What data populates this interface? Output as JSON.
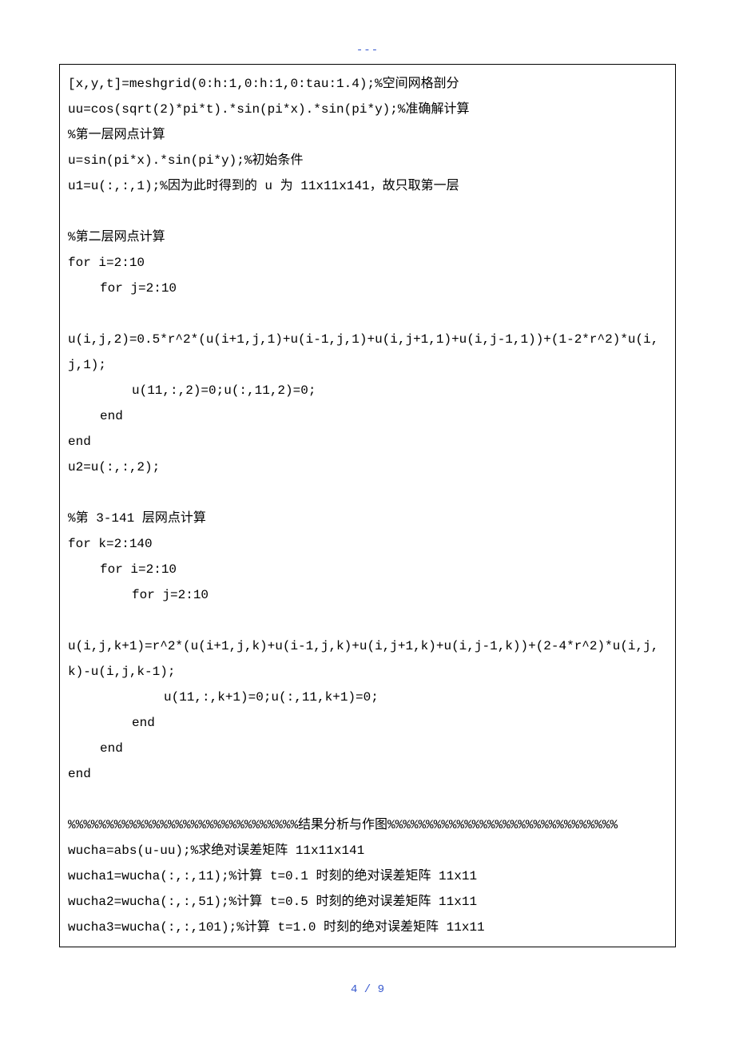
{
  "header": {
    "dashes": "---"
  },
  "code": {
    "lines": [
      {
        "cls": "",
        "text": "[x,y,t]=meshgrid(0:h:1,0:h:1,0:tau:1.4);%空间网格剖分"
      },
      {
        "cls": "",
        "text": "uu=cos(sqrt(2)*pi*t).*sin(pi*x).*sin(pi*y);%准确解计算"
      },
      {
        "cls": "",
        "text": "%第一层网点计算"
      },
      {
        "cls": "",
        "text": "u=sin(pi*x).*sin(pi*y);%初始条件"
      },
      {
        "cls": "",
        "text": "u1=u(:,:,1);%因为此时得到的 u 为 11x11x141，故只取第一层"
      },
      {
        "cls": "blank",
        "text": ""
      },
      {
        "cls": "",
        "text": "%第二层网点计算"
      },
      {
        "cls": "",
        "text": "for i=2:10"
      },
      {
        "cls": "indent-1",
        "text": "for j=2:10"
      },
      {
        "cls": "blank",
        "text": ""
      },
      {
        "cls": "",
        "text": "u(i,j,2)=0.5*r^2*(u(i+1,j,1)+u(i-1,j,1)+u(i,j+1,1)+u(i,j-1,1))+(1-2*r^2)*u(i,j,1);"
      },
      {
        "cls": "indent-2",
        "text": "u(11,:,2)=0;u(:,11,2)=0;"
      },
      {
        "cls": "indent-1",
        "text": "end"
      },
      {
        "cls": "",
        "text": "end"
      },
      {
        "cls": "",
        "text": "u2=u(:,:,2);"
      },
      {
        "cls": "blank",
        "text": ""
      },
      {
        "cls": "",
        "text": "%第 3-141 层网点计算"
      },
      {
        "cls": "",
        "text": "for k=2:140"
      },
      {
        "cls": "indent-1",
        "text": "for i=2:10"
      },
      {
        "cls": "indent-2",
        "text": "for j=2:10"
      },
      {
        "cls": "blank",
        "text": ""
      },
      {
        "cls": "",
        "text": "u(i,j,k+1)=r^2*(u(i+1,j,k)+u(i-1,j,k)+u(i,j+1,k)+u(i,j-1,k))+(2-4*r^2)*u(i,j,k)-u(i,j,k-1);"
      },
      {
        "cls": "indent-3",
        "text": "u(11,:,k+1)=0;u(:,11,k+1)=0;"
      },
      {
        "cls": "indent-2",
        "text": "end"
      },
      {
        "cls": "indent-1",
        "text": "end"
      },
      {
        "cls": "",
        "text": "end"
      },
      {
        "cls": "blank",
        "text": ""
      },
      {
        "cls": "",
        "text": "%%%%%%%%%%%%%%%%%%%%%%%%%%%%%%结果分析与作图%%%%%%%%%%%%%%%%%%%%%%%%%%%%%%"
      },
      {
        "cls": "",
        "text": "wucha=abs(u-uu);%求绝对误差矩阵 11x11x141"
      },
      {
        "cls": "",
        "text": "wucha1=wucha(:,:,11);%计算 t=0.1 时刻的绝对误差矩阵 11x11"
      },
      {
        "cls": "",
        "text": "wucha2=wucha(:,:,51);%计算 t=0.5 时刻的绝对误差矩阵 11x11"
      },
      {
        "cls": "",
        "text": "wucha3=wucha(:,:,101);%计算 t=1.0 时刻的绝对误差矩阵 11x11"
      }
    ]
  },
  "footer": {
    "page_num": "4 / 9"
  }
}
